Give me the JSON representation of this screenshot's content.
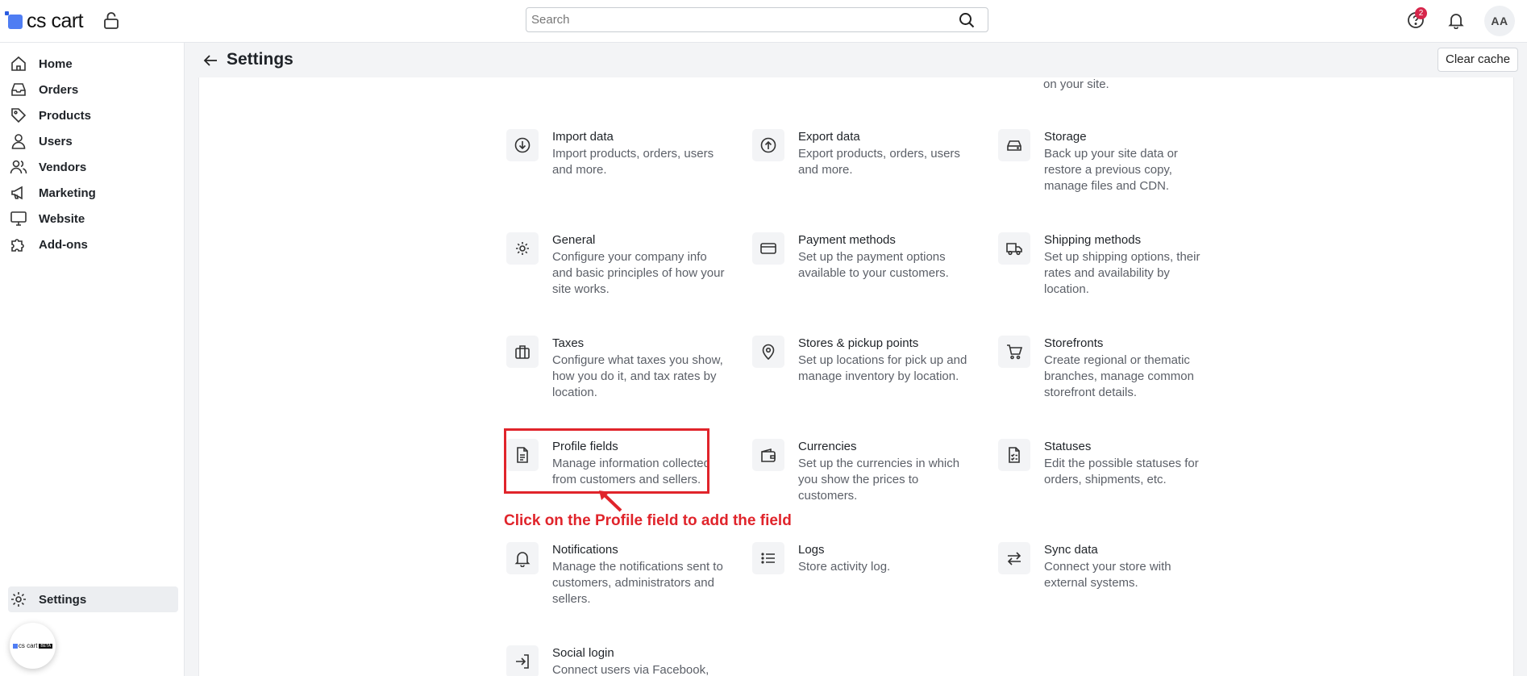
{
  "app": {
    "logo_text": "cs cart"
  },
  "search": {
    "placeholder": "Search"
  },
  "header": {
    "notification_count": "2",
    "avatar_initials": "AA"
  },
  "sidebar": {
    "items": [
      {
        "label": "Home"
      },
      {
        "label": "Orders"
      },
      {
        "label": "Products"
      },
      {
        "label": "Users"
      },
      {
        "label": "Vendors"
      },
      {
        "label": "Marketing"
      },
      {
        "label": "Website"
      },
      {
        "label": "Add-ons"
      }
    ],
    "settings_label": "Settings",
    "badge_text": "cs cart",
    "badge_tag": "BETA"
  },
  "page": {
    "title": "Settings",
    "clear_cache_label": "Clear cache",
    "top_fragment": "on your site."
  },
  "settings_cards": [
    {
      "title": "Import data",
      "desc": "Import products, orders, users and more."
    },
    {
      "title": "Export data",
      "desc": "Export products, orders, users and more."
    },
    {
      "title": "Storage",
      "desc": "Back up your site data or restore a previous copy, manage files and CDN."
    },
    {
      "title": "General",
      "desc": "Configure your company info and basic principles of how your site works."
    },
    {
      "title": "Payment methods",
      "desc": "Set up the payment options available to your customers."
    },
    {
      "title": "Shipping methods",
      "desc": "Set up shipping options, their rates and availability by location."
    },
    {
      "title": "Taxes",
      "desc": "Configure what taxes you show, how you do it, and tax rates by location."
    },
    {
      "title": "Stores & pickup points",
      "desc": "Set up locations for pick up and manage inventory by location."
    },
    {
      "title": "Storefronts",
      "desc": "Create regional or thematic branches, manage common storefront details."
    },
    {
      "title": "Profile fields",
      "desc": "Manage information collected from customers and sellers."
    },
    {
      "title": "Currencies",
      "desc": "Set up the currencies in which you show the prices to customers."
    },
    {
      "title": "Statuses",
      "desc": "Edit the possible statuses for orders, shipments, etc."
    },
    {
      "title": "Notifications",
      "desc": "Manage the notifications sent to customers, administrators and sellers."
    },
    {
      "title": "Logs",
      "desc": "Store activity log."
    },
    {
      "title": "Sync data",
      "desc": "Connect your store with external systems."
    },
    {
      "title": "Social login",
      "desc": "Connect users via Facebook,"
    }
  ],
  "annotation": {
    "text": "Click on the Profile field to add the field",
    "color": "#e0242b"
  }
}
